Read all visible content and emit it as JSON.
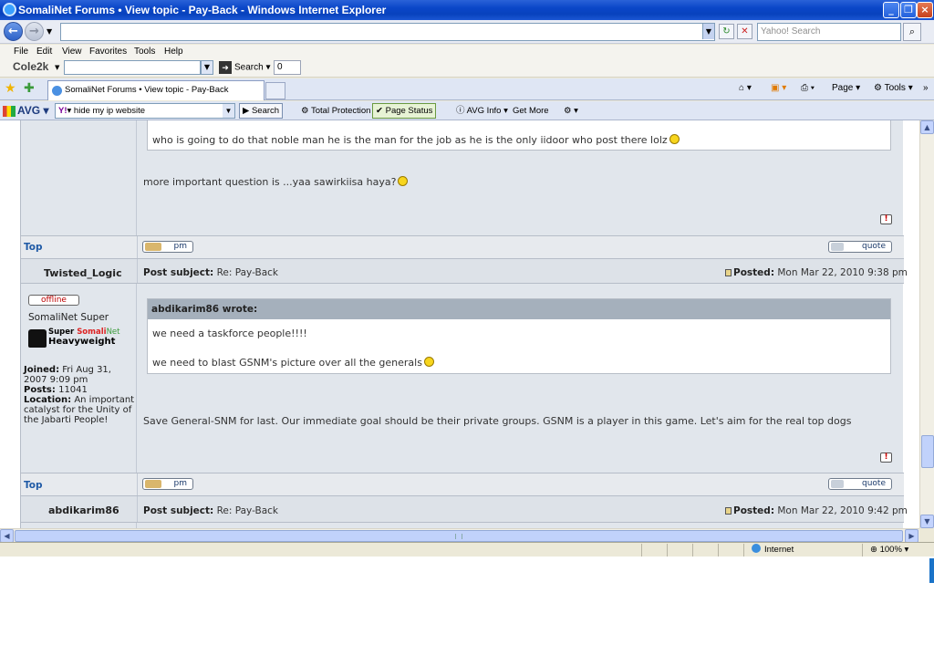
{
  "window": {
    "title": "SomaliNet Forums • View topic - Pay-Back - Windows Internet Explorer"
  },
  "address": {
    "url": "",
    "search_placeholder": "Yahoo! Search"
  },
  "menu": [
    "File",
    "Edit",
    "View",
    "Favorites",
    "Tools",
    "Help"
  ],
  "cole2k": {
    "logo": "Cole2k",
    "search_label": "Search",
    "counter": "0"
  },
  "tabs": {
    "active": "SomaliNet Forums • View topic - Pay-Back",
    "tools": {
      "page": "Page",
      "tools": "Tools"
    }
  },
  "avg": {
    "logo": "AVG",
    "search_value": "hide my ip website",
    "search_button": "Search",
    "total_protection": "Total Protection",
    "page_status": "Page Status",
    "avg_info": "AVG Info",
    "get_more": "Get More"
  },
  "post1": {
    "quote_text": "who is going to do that noble man he is the man for the job as he is the only iidoor who post there lolz",
    "body": "more important question is ...yaa sawirkiisa haya?",
    "top": "Top",
    "pm": "pm",
    "quote": "quote"
  },
  "post2": {
    "author": "Twisted_Logic",
    "subject_label": "Post subject:",
    "subject": "Re: Pay-Back",
    "posted_label": "Posted:",
    "posted": "Mon Mar 22, 2010 9:38 pm",
    "status": "offline",
    "rank_title": "SomaliNet Super",
    "rank_img": {
      "super": "Super",
      "somali": "Somali",
      "net": "Net",
      "heavy": "Heavyweight"
    },
    "joined_label": "Joined:",
    "joined": "Fri Aug 31, 2007 9:09 pm",
    "posts_label": "Posts:",
    "posts": "11041",
    "location_label": "Location:",
    "location": "An important catalyst for the Unity of the Jabarti People!",
    "quote_author": "abdikarim86 wrote:",
    "quote_line1": "we need a taskforce people!!!!",
    "quote_line2": "we need to blast GSNM's picture over all the generals",
    "body": "Save General-SNM for last. Our immediate goal should be their private groups. GSNM is a player in this game. Let's aim for the real top dogs",
    "top": "Top",
    "pm": "pm",
    "quote": "quote"
  },
  "post3": {
    "author": "abdikarim86",
    "subject_label": "Post subject:",
    "subject": "Re: Pay-Back",
    "posted_label": "Posted:",
    "posted": "Mon Mar 22, 2010 9:42 pm"
  },
  "status": {
    "zone": "Internet",
    "zoom": "100%"
  }
}
